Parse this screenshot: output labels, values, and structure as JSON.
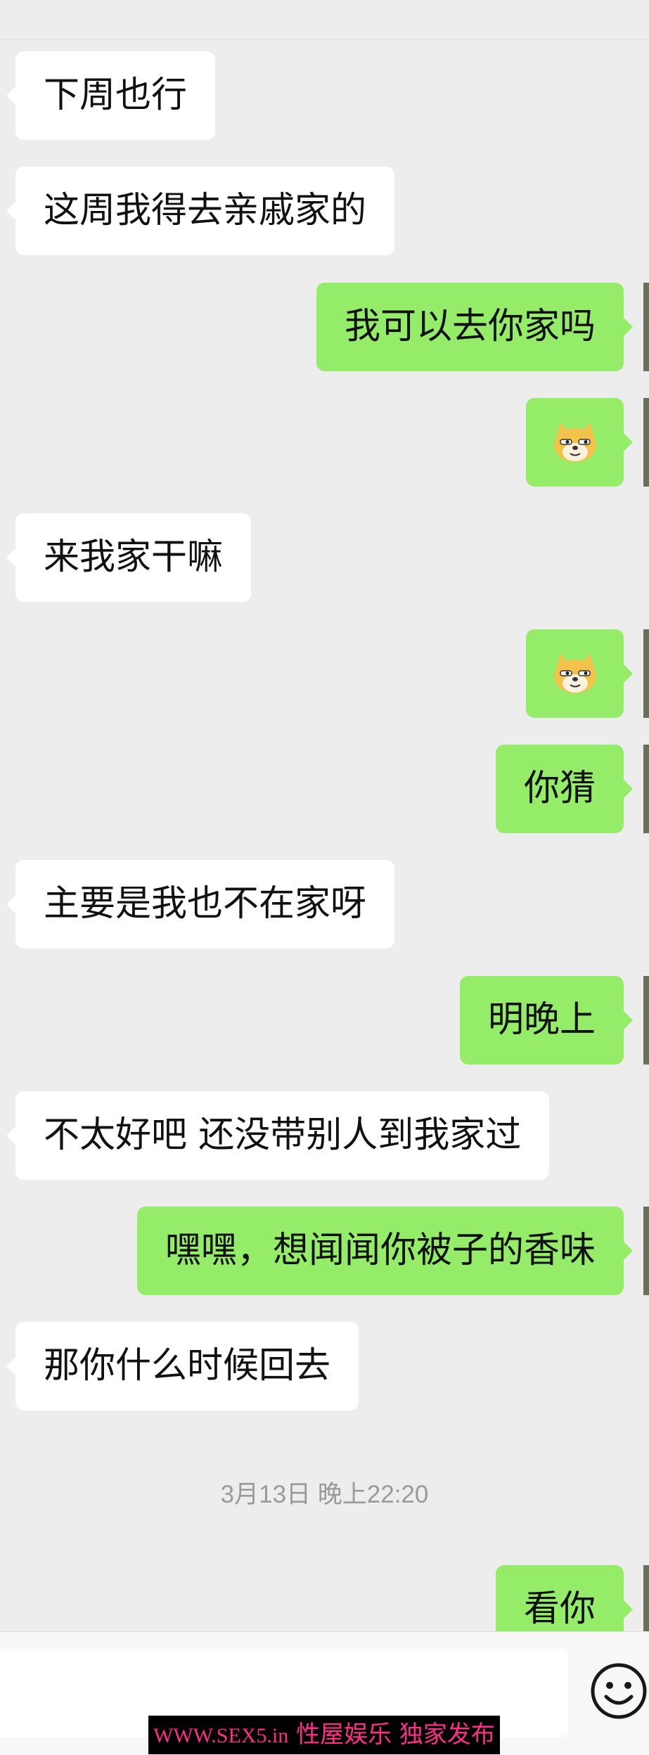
{
  "messages": [
    {
      "side": "in",
      "text": "下周也行"
    },
    {
      "side": "in",
      "text": "这周我得去亲戚家的"
    },
    {
      "side": "out",
      "text": "我可以去你家吗"
    },
    {
      "side": "out",
      "emoji": "doge-emoji-icon"
    },
    {
      "side": "in",
      "text": "来我家干嘛"
    },
    {
      "side": "out",
      "emoji": "doge-emoji-icon"
    },
    {
      "side": "out",
      "text": "你猜"
    },
    {
      "side": "in",
      "text": "主要是我也不在家呀"
    },
    {
      "side": "out",
      "text": "明晚上"
    },
    {
      "side": "in",
      "text": "不太好吧 还没带别人到我家过"
    },
    {
      "side": "out",
      "text": "嘿嘿，想闻闻你被子的香味"
    },
    {
      "side": "in",
      "text": "那你什么时候回去"
    },
    {
      "side": "out",
      "text": "看你"
    }
  ],
  "timestamp": "3月13日 晚上22:20",
  "input_bar": {
    "emoji_button_icon": "smiley-face-icon"
  },
  "watermark": {
    "url": "WWW.SEX5.in",
    "text": "性屋娱乐 独家发布"
  },
  "colors": {
    "outgoing_bubble": "#95ec69",
    "incoming_bubble": "#ffffff",
    "background": "#ededed"
  }
}
